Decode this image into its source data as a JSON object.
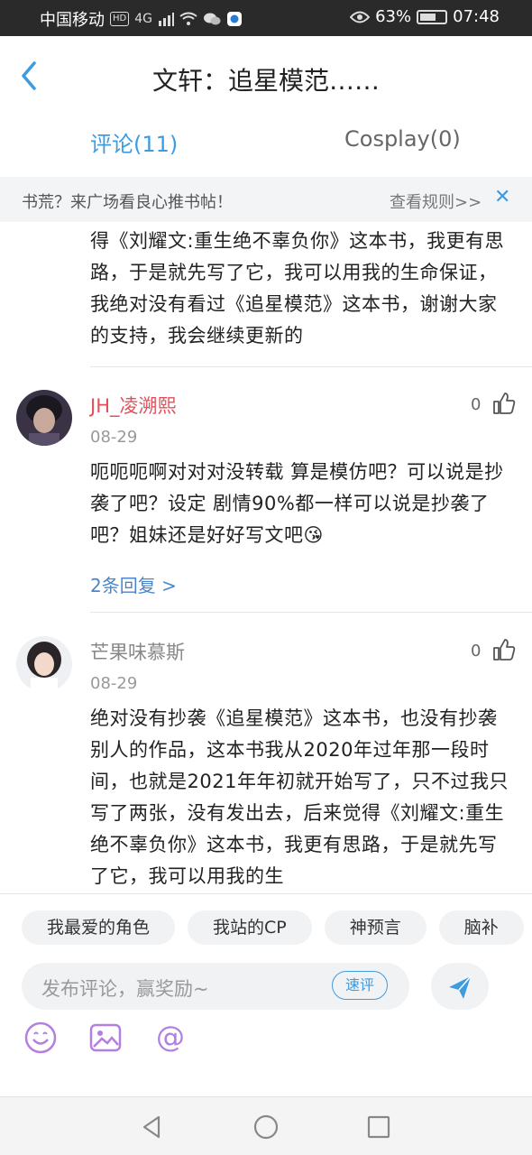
{
  "status_bar": {
    "carrier": "中国移动",
    "network": "4G",
    "battery": "63%",
    "time": "07:48",
    "icons": [
      "hd-icon",
      "signal-icon",
      "wifi-icon",
      "wechat-icon",
      "app-icon",
      "eye-icon",
      "battery-icon"
    ]
  },
  "header": {
    "title": "文轩：追星模范……",
    "back_icon": "back-chevron-icon"
  },
  "tabs": [
    {
      "label": "评论(11)",
      "active": true
    },
    {
      "label": "Cosplay(0)",
      "active": false
    }
  ],
  "notice": {
    "text": "书荒？来广场看良心推书帖！",
    "link": "查看规则>>",
    "close": "✕"
  },
  "continued_text": "得《刘耀文:重生绝不辜负你》这本书，我更有思路，于是就先写了它，我可以用我的生命保证，我绝对没有看过《追星模范》这本书，谢谢大家的支持，我会继续更新的",
  "comments": [
    {
      "username": "JH_凌溯熙",
      "username_color": "#e0505a",
      "date": "08-29",
      "likes": "0",
      "text": "呃呃呃啊对对对没转载 算是模仿吧？可以说是抄袭了吧？设定 剧情90%都一样可以说是抄袭了吧？姐妹还是好好写文吧😘",
      "replies": "2条回复 >"
    },
    {
      "username": "芒果味慕斯",
      "username_color": "#888888",
      "date": "08-29",
      "likes": "0",
      "text": "绝对没有抄袭《追星模范》这本书，也没有抄袭别人的作品，这本书我从2020年过年那一段时间，也就是2021年年初就开始写了，只不过我只写了两张，没有发出去，后来觉得《刘耀文:重生绝不辜负你》这本书，我更有思路，于是就先写了它，我可以用我的生"
    }
  ],
  "chips": [
    "我最爱的角色",
    "我站的CP",
    "神预言",
    "脑补"
  ],
  "input": {
    "placeholder": "发布评论，赢奖励~",
    "quick_label": "速评"
  },
  "colors": {
    "accent": "#3d9be0",
    "link": "#4a86c9",
    "tool_purple": "#b37fe0"
  }
}
